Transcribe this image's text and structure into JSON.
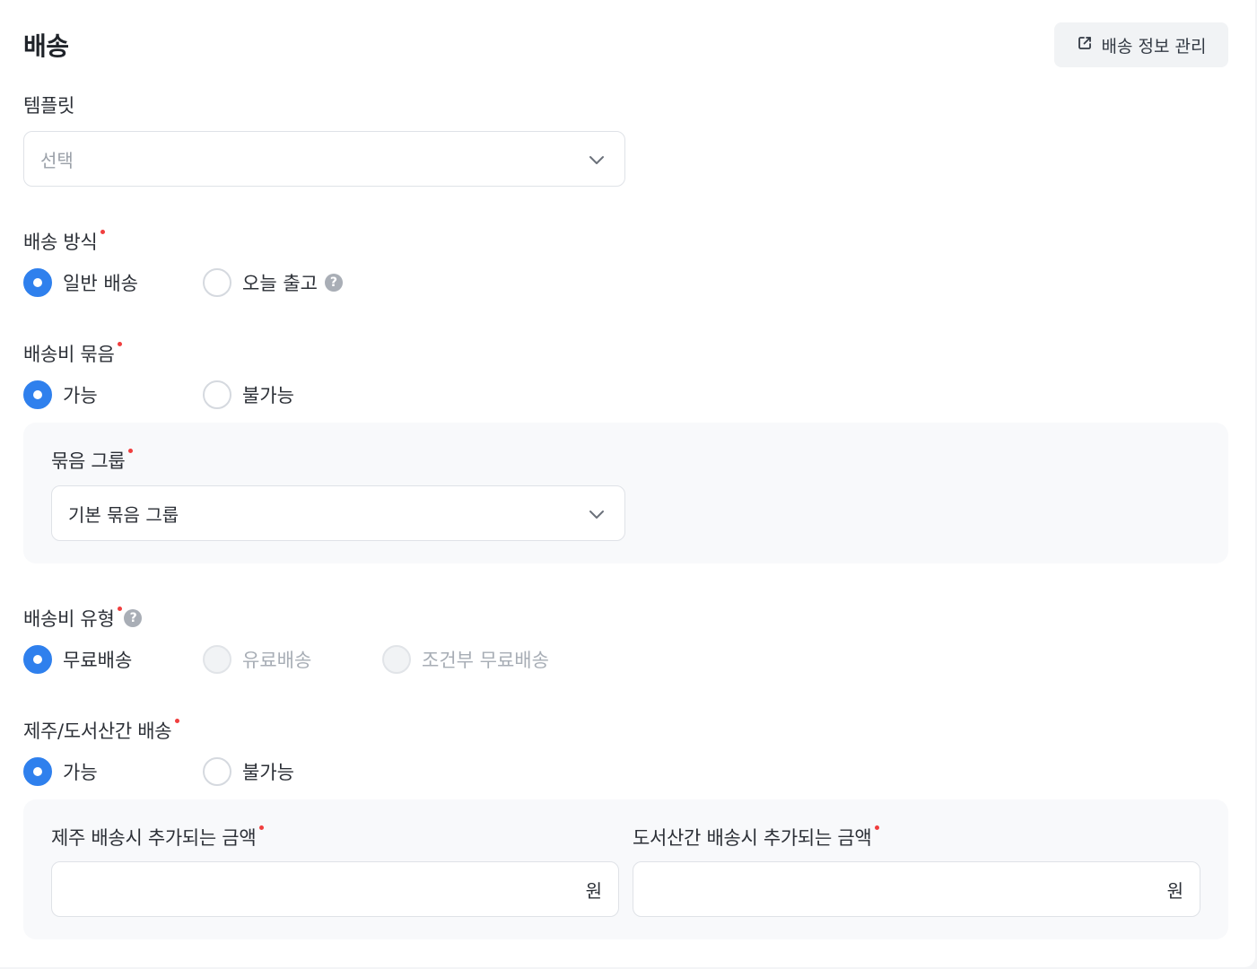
{
  "section_title": "배송",
  "manage_button": {
    "label": "배송 정보 관리",
    "icon": "external-link-icon"
  },
  "template": {
    "label": "템플릿",
    "placeholder": "선택"
  },
  "shipping_method": {
    "label": "배송 방식",
    "required": true,
    "options": [
      {
        "label": "일반 배송",
        "checked": true
      },
      {
        "label": "오늘 출고",
        "checked": false,
        "help": "?"
      }
    ]
  },
  "shipping_bundle": {
    "label": "배송비 묶음",
    "required": true,
    "options": [
      {
        "label": "가능",
        "checked": true
      },
      {
        "label": "불가능",
        "checked": false
      }
    ],
    "group": {
      "label": "묶음 그룹",
      "value": "기본 묶음 그룹"
    }
  },
  "shipping_fee_type": {
    "label": "배송비 유형",
    "required": true,
    "help": "?",
    "options": [
      {
        "label": "무료배송",
        "checked": true,
        "disabled": false
      },
      {
        "label": "유료배송",
        "checked": false,
        "disabled": true
      },
      {
        "label": "조건부 무료배송",
        "checked": false,
        "disabled": true
      }
    ]
  },
  "jeju_island": {
    "label": "제주/도서산간 배송",
    "required": true,
    "options": [
      {
        "label": "가능",
        "checked": true
      },
      {
        "label": "불가능",
        "checked": false
      }
    ],
    "jeju_fee": {
      "label": "제주 배송시 추가되는 금액",
      "unit": "원"
    },
    "island_fee": {
      "label": "도서산간 배송시 추가되는 금액",
      "unit": "원"
    }
  },
  "colors": {
    "accent": "#2f80ed",
    "required": "#f03e3e",
    "panel": "#f8f9fb"
  }
}
